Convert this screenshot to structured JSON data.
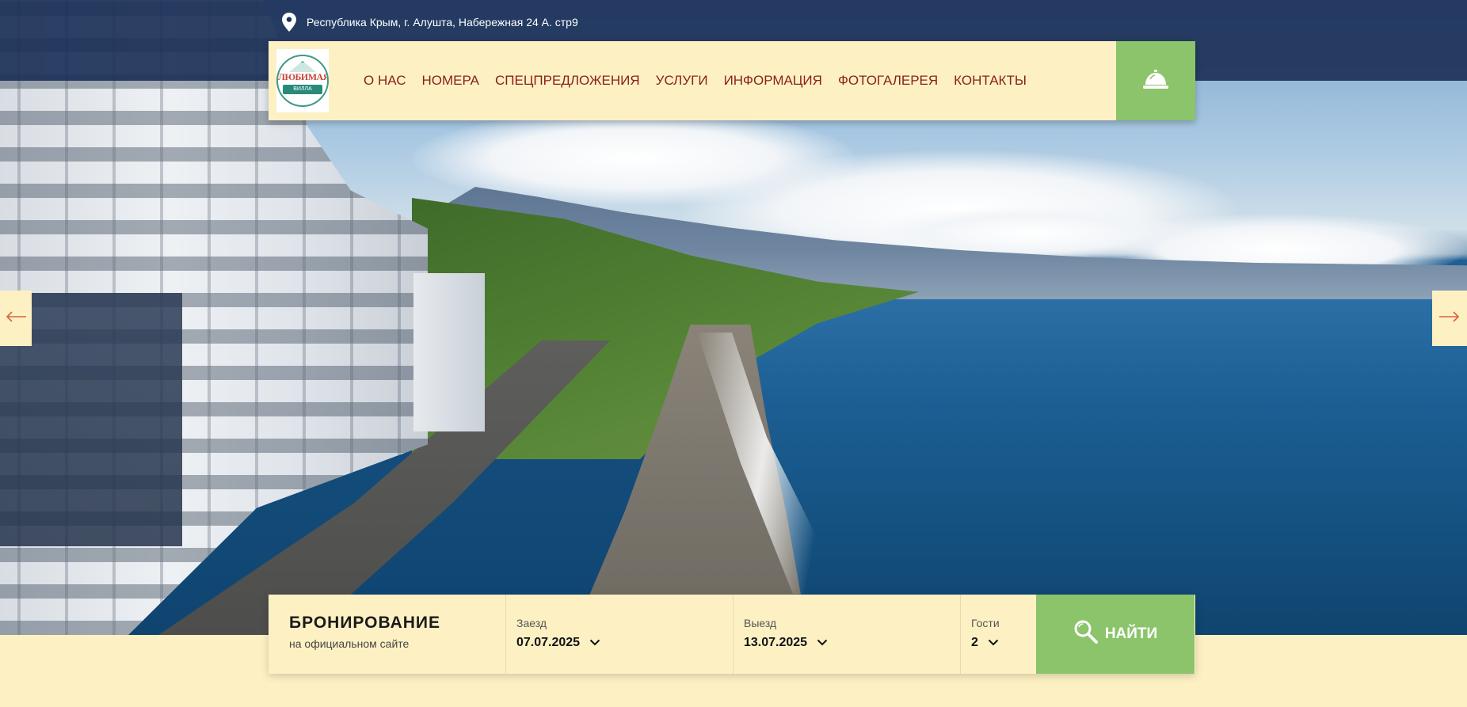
{
  "topbar": {
    "address": "Республика Крым, г. Алушта, Набережная 24 А. стр9",
    "pin_icon": "map-pin-icon"
  },
  "logo": {
    "title": "ЛЮБИМАЯ",
    "subtitle": "ВИЛЛА"
  },
  "nav": {
    "items": [
      {
        "label": "О НАС"
      },
      {
        "label": "НОМЕРА"
      },
      {
        "label": "СПЕЦПРЕДЛОЖЕНИЯ"
      },
      {
        "label": "УСЛУГИ"
      },
      {
        "label": "ИНФОРМАЦИЯ"
      },
      {
        "label": "ФОТОГАЛЕРЕЯ"
      },
      {
        "label": "КОНТАКТЫ"
      }
    ],
    "bell_icon": "reception-bell-icon"
  },
  "slider": {
    "prev_icon": "arrow-left-icon",
    "next_icon": "arrow-right-icon"
  },
  "booking": {
    "title": "БРОНИРОВАНИЕ",
    "subtitle": "на официальном сайте",
    "checkin": {
      "label": "Заезд",
      "value": "07.07.2025"
    },
    "checkout": {
      "label": "Выезд",
      "value": "13.07.2025"
    },
    "guests": {
      "label": "Гости",
      "value": "2"
    },
    "search_label": "НАЙТИ",
    "search_icon": "search-icon"
  },
  "colors": {
    "topbar": "#1c3158",
    "cream": "#fdf1c4",
    "accent_green": "#8bc46a",
    "menu_text": "#8b1f1a"
  }
}
